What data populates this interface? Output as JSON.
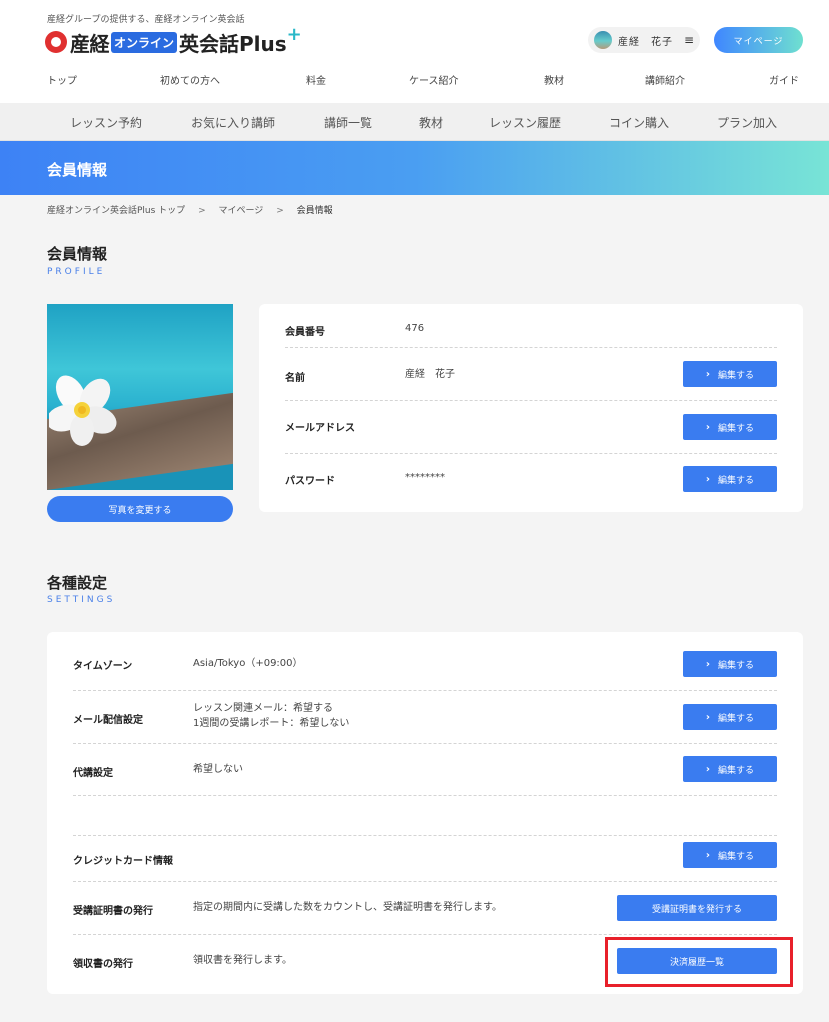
{
  "header": {
    "tagline": "産経グループの提供する、産経オンライン英会話",
    "logo": {
      "main": "産経",
      "online": "オンライン",
      "rest": "英会話Plus",
      "plus": "+"
    },
    "user_name": "産経　花子",
    "menu_icon": "≡",
    "mypage_label": "マイページ"
  },
  "topnav": [
    "トップ",
    "初めての方へ",
    "料金",
    "ケース紹介",
    "教材",
    "講師紹介",
    "ガイド"
  ],
  "subnav": [
    "レッスン予約",
    "お気に入り講師",
    "講師一覧",
    "教材",
    "レッスン履歴",
    "コイン購入",
    "プラン加入"
  ],
  "banner": {
    "title": "会員情報"
  },
  "breadcrumb": {
    "items": [
      "産経オンライン英会話Plus トップ",
      "マイページ"
    ],
    "separator": ">",
    "current": "会員情報"
  },
  "profile": {
    "title": "会員情報",
    "subtitle": "PROFILE",
    "photo_button": "写真を変更する",
    "rows": [
      {
        "label": "会員番号",
        "value": "476",
        "editable": false
      },
      {
        "label": "名前",
        "value": "産経　花子",
        "editable": true
      },
      {
        "label": "メールアドレス",
        "value": "",
        "editable": true
      },
      {
        "label": "パスワード",
        "value": "********",
        "editable": true
      }
    ],
    "edit_label": "編集する"
  },
  "settings": {
    "title": "各種設定",
    "subtitle": "SETTINGS",
    "timezone": {
      "label": "タイムゾーン",
      "value": "Asia/Tokyo（+09:00）"
    },
    "mail": {
      "label": "メール配信設定",
      "line1": "レッスン関連メール：希望する",
      "line2": "1週間の受講レポート：希望しない"
    },
    "substitute": {
      "label": "代講設定",
      "value": "希望しない"
    },
    "credit": {
      "label": "クレジットカード情報"
    },
    "certificate": {
      "label": "受講証明書の発行",
      "value": "指定の期間内に受講した数をカウントし、受講証明書を発行します。",
      "button": "受講証明書を発行する"
    },
    "receipt": {
      "label": "領収書の発行",
      "value": "領収書を発行します。",
      "button": "決済履歴一覧"
    },
    "edit_label": "編集する"
  },
  "colors": {
    "accent": "#3a7cf0",
    "highlight": "#e8202a"
  }
}
